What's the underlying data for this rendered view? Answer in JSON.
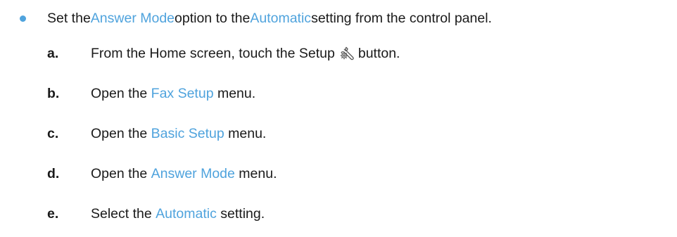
{
  "intro": {
    "pre": "Set the ",
    "link1": "Answer Mode",
    "mid": " option to the ",
    "link2": "Automatic",
    "post": " setting from the control panel."
  },
  "steps": [
    {
      "letter": "a.",
      "pre": "From the Home screen, touch the Setup",
      "icon": "setup-icon",
      "post": "button."
    },
    {
      "letter": "b.",
      "pre": "Open the ",
      "link": "Fax Setup",
      "post": " menu."
    },
    {
      "letter": "c.",
      "pre": "Open the ",
      "link": "Basic Setup",
      "post": " menu."
    },
    {
      "letter": "d.",
      "pre": "Open the ",
      "link": "Answer Mode",
      "post": " menu."
    },
    {
      "letter": "e.",
      "pre": "Select the ",
      "link": "Automatic",
      "post": " setting."
    }
  ],
  "colors": {
    "accent": "#4fa3dd",
    "text": "#1a1a1a"
  }
}
